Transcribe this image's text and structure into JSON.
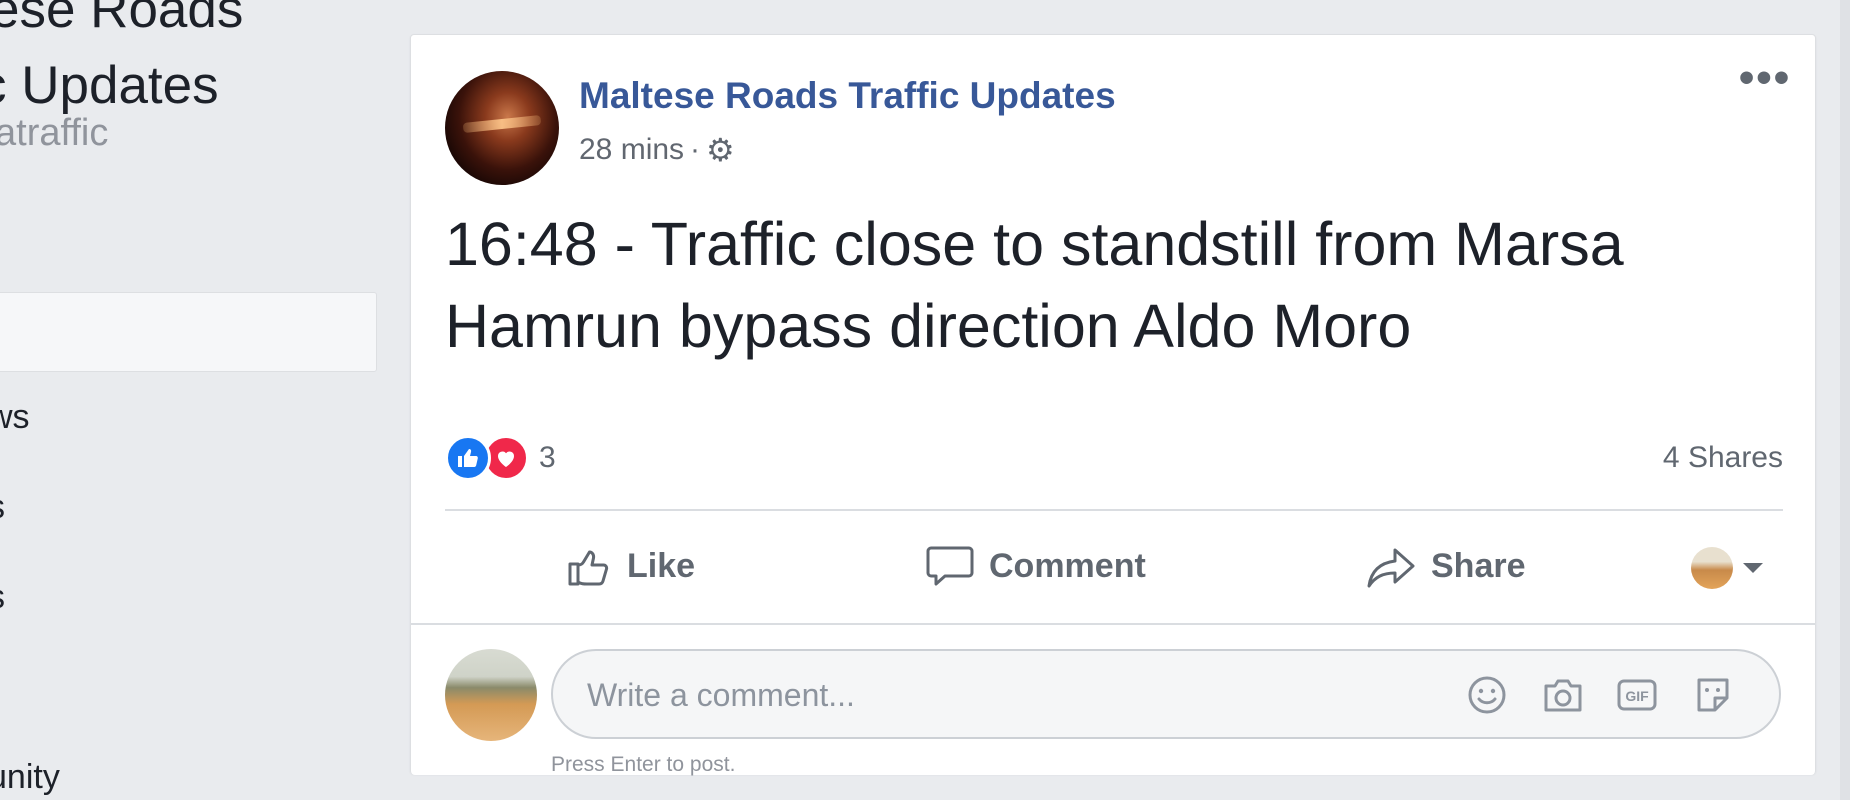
{
  "sidebar": {
    "title_line1": "ese Roads",
    "title_line2": "c Updates",
    "handle": "atraffic",
    "nav_items": [
      "ws",
      "s",
      "s",
      "unity"
    ]
  },
  "post": {
    "page_name": "Maltese Roads Traffic Updates",
    "time": "28 mins",
    "separator": "·",
    "privacy_icon": "gear-icon",
    "text": "16:48 - Traffic close to standstill from Marsa Hamrun bypass direction Aldo Moro",
    "reaction_count": "3",
    "reaction_types": [
      "like",
      "love"
    ],
    "shares": "4 Shares",
    "more_label": "•••"
  },
  "actions": {
    "like": "Like",
    "comment": "Comment",
    "share": "Share"
  },
  "comment": {
    "placeholder": "Write a comment...",
    "hint": "Press Enter to post.",
    "icons": [
      "emoji-icon",
      "camera-icon",
      "gif-icon",
      "sticker-icon"
    ]
  },
  "colors": {
    "background": "#e9ebee",
    "link": "#385898",
    "like": "#1877f2",
    "love": "#f0284a",
    "secondary_text": "#606770"
  }
}
